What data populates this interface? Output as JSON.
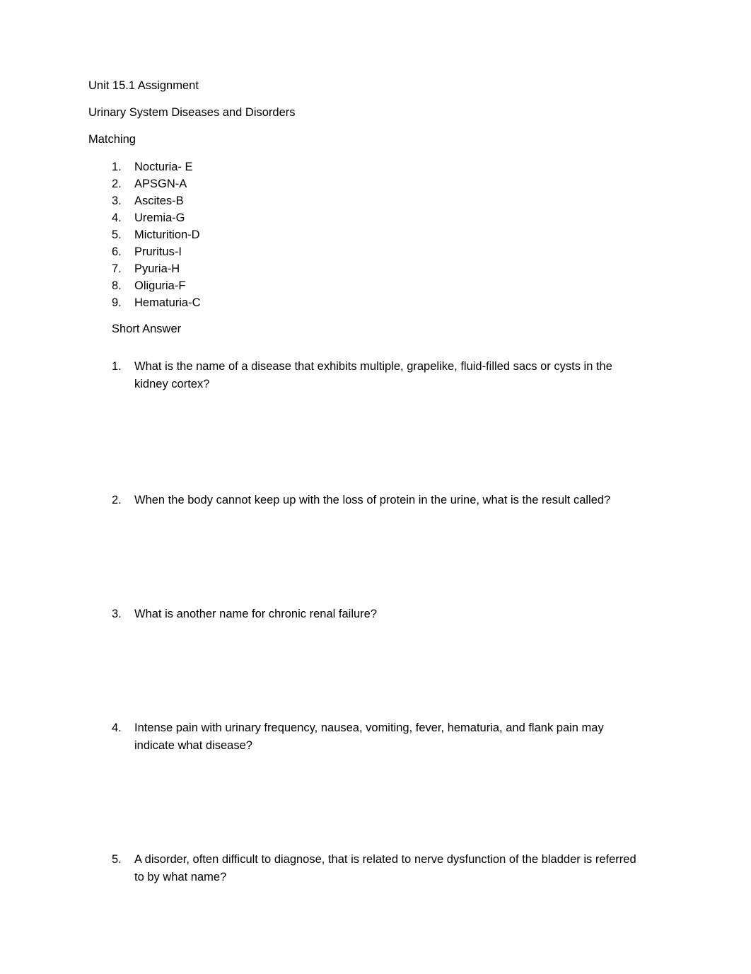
{
  "document": {
    "header": {
      "title": "Unit 15.1 Assignment",
      "subtitle": "Urinary System Diseases and Disorders",
      "section_label": "Matching"
    },
    "matching": {
      "items": [
        {
          "number": "1.",
          "text": "Nocturia- E"
        },
        {
          "number": "2.",
          "text": "APSGN-A"
        },
        {
          "number": "3.",
          "text": "Ascites-B"
        },
        {
          "number": "4.",
          "text": "Uremia-G"
        },
        {
          "number": "5.",
          "text": "Micturition-D"
        },
        {
          "number": "6.",
          "text": "Pruritus-I"
        },
        {
          "number": "7.",
          "text": "Pyuria-H"
        },
        {
          "number": "8.",
          "text": "Oliguria-F"
        },
        {
          "number": "9.",
          "text": "Hematuria-C"
        }
      ]
    },
    "short_answer": {
      "heading": "Short Answer",
      "questions": [
        {
          "number": "1.",
          "text": "What is the name of a disease that exhibits multiple, grapelike, fluid-filled sacs or cysts in the kidney cortex?"
        },
        {
          "number": "2.",
          "text": "When the body cannot keep up with the loss of protein in the urine, what is the result called?"
        },
        {
          "number": "3.",
          "text": "What is another name for chronic renal failure?"
        },
        {
          "number": "4.",
          "text": "Intense pain with urinary frequency, nausea, vomiting, fever, hematuria, and flank pain may indicate what disease?"
        },
        {
          "number": "5.",
          "text": "A disorder, often difficult to diagnose, that is related to nerve dysfunction of the bladder is referred to by what name?"
        }
      ]
    }
  }
}
